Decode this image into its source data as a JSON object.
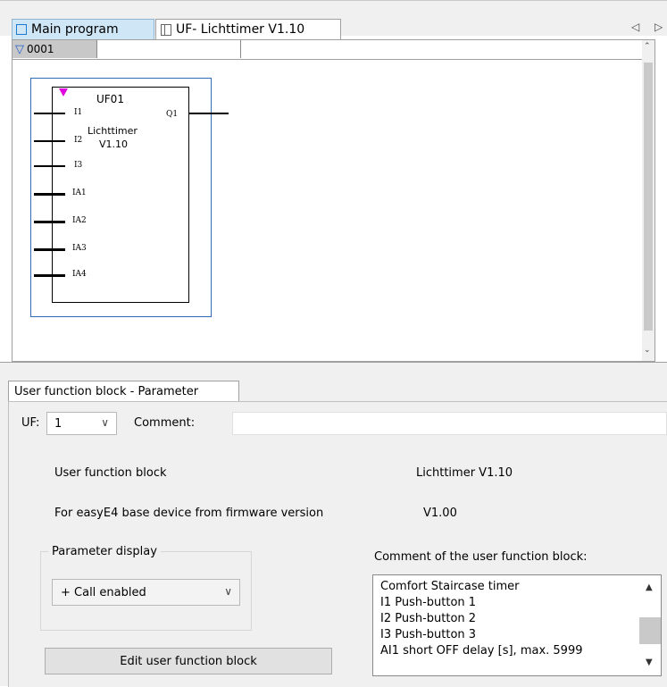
{
  "tabs": {
    "main_label": "Main program",
    "uf_label": "UF- Lichttimer V1.10"
  },
  "editor": {
    "row_number": "0001",
    "block": {
      "id": "UF01",
      "name_line1": "Lichttimer",
      "name_line2": "V1.10",
      "inputs": [
        "I1",
        "I2",
        "I3",
        "IA1",
        "IA2",
        "IA3",
        "IA4"
      ],
      "output": "Q1"
    }
  },
  "params": {
    "tab_label": "User function block - Parameter",
    "uf_label": "UF:",
    "uf_value": "1",
    "comment_label": "Comment:",
    "comment_value": "",
    "ufb_label": "User function block",
    "ufb_value": "Lichttimer V1.10",
    "fw_label": "For easyE4 base device from firmware version",
    "fw_value": "V1.00",
    "display_group_title": "Parameter display",
    "display_value": "+ Call enabled",
    "ufb_comment_label": "Comment of the user function block:",
    "ufb_comment_lines": [
      "Comfort Staircase timer",
      "I1 Push-button 1",
      "I2 Push-button 2",
      "I3 Push-button 3",
      "AI1 short OFF delay [s], max. 5999"
    ],
    "edit_button": "Edit user function block"
  }
}
